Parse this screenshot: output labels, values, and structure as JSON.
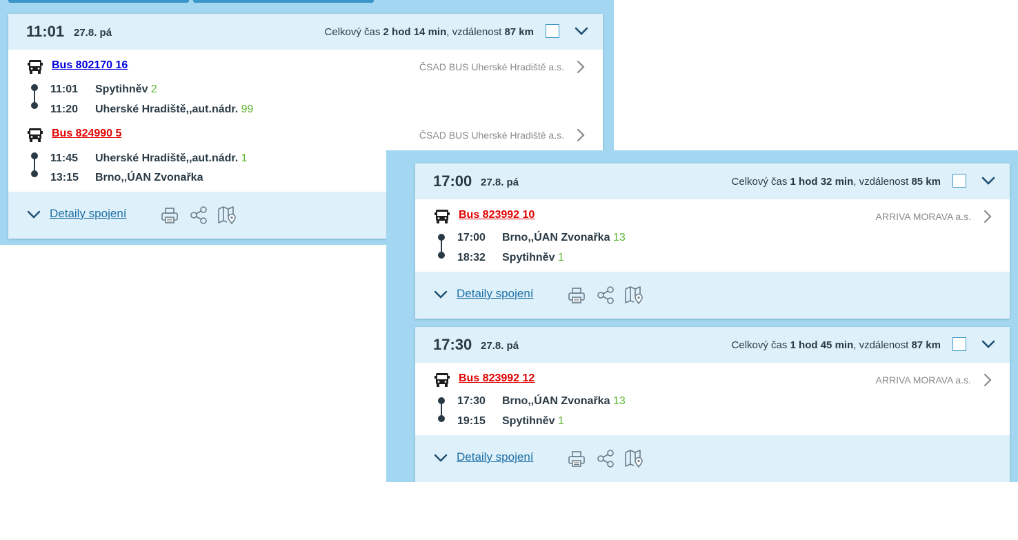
{
  "cards": [
    {
      "time": "11:01",
      "date": "27.8. pá",
      "summary_prefix": "Celkový čas ",
      "duration": "2 hod 14 min",
      "summary_mid": ", vzdálenost ",
      "distance": "87 km",
      "legs": [
        {
          "line": "Bus 802170 16",
          "line_color": "#0000e0",
          "carrier": "ČSAD BUS Uherské Hradiště a.s.",
          "stops": [
            {
              "time": "11:01",
              "name": "Spytihněv",
              "platform": "2"
            },
            {
              "time": "11:20",
              "name": "Uherské Hradiště,,aut.nádr.",
              "platform": "99"
            }
          ]
        },
        {
          "line": "Bus 824990 5",
          "line_color": "#e00000",
          "carrier": "ČSAD BUS Uherské Hradiště a.s.",
          "stops": [
            {
              "time": "11:45",
              "name": "Uherské Hradiště,,aut.nádr.",
              "platform": "1"
            },
            {
              "time": "13:15",
              "name": "Brno,,ÚAN Zvonařka",
              "platform": ""
            }
          ]
        }
      ],
      "details_label": "Detaily spojení"
    },
    {
      "time": "17:00",
      "date": "27.8. pá",
      "summary_prefix": "Celkový čas ",
      "duration": "1 hod 32 min",
      "summary_mid": ", vzdálenost ",
      "distance": "85 km",
      "legs": [
        {
          "line": "Bus 823992 10",
          "line_color": "#e00000",
          "carrier": "ARRIVA MORAVA a.s.",
          "stops": [
            {
              "time": "17:00",
              "name": "Brno,,ÚAN Zvonařka",
              "platform": "13"
            },
            {
              "time": "18:32",
              "name": "Spytihněv",
              "platform": "1"
            }
          ]
        }
      ],
      "details_label": "Detaily spojení"
    },
    {
      "time": "17:30",
      "date": "27.8. pá",
      "summary_prefix": "Celkový čas ",
      "duration": "1 hod 45 min",
      "summary_mid": ", vzdálenost ",
      "distance": "87 km",
      "legs": [
        {
          "line": "Bus 823992 12",
          "line_color": "#e00000",
          "carrier": "ARRIVA MORAVA a.s.",
          "stops": [
            {
              "time": "17:30",
              "name": "Brno,,ÚAN Zvonařka",
              "platform": "13"
            },
            {
              "time": "19:15",
              "name": "Spytihněv",
              "platform": "1"
            }
          ]
        }
      ],
      "details_label": "Detaily spojení"
    }
  ],
  "icons": {
    "vehicle": "bus-icon",
    "expand": "chevron-down-icon",
    "carrier_more": "chevron-right-icon",
    "print": "printer-icon",
    "share": "share-icon",
    "map": "map-pin-icon"
  },
  "colors": {
    "panel_bg": "#a3d6f0",
    "card_header_bg": "#def0f9",
    "link_blue": "#1d6fa5",
    "platform_green": "#5cb531",
    "checkbox_border": "#3a96c9"
  }
}
